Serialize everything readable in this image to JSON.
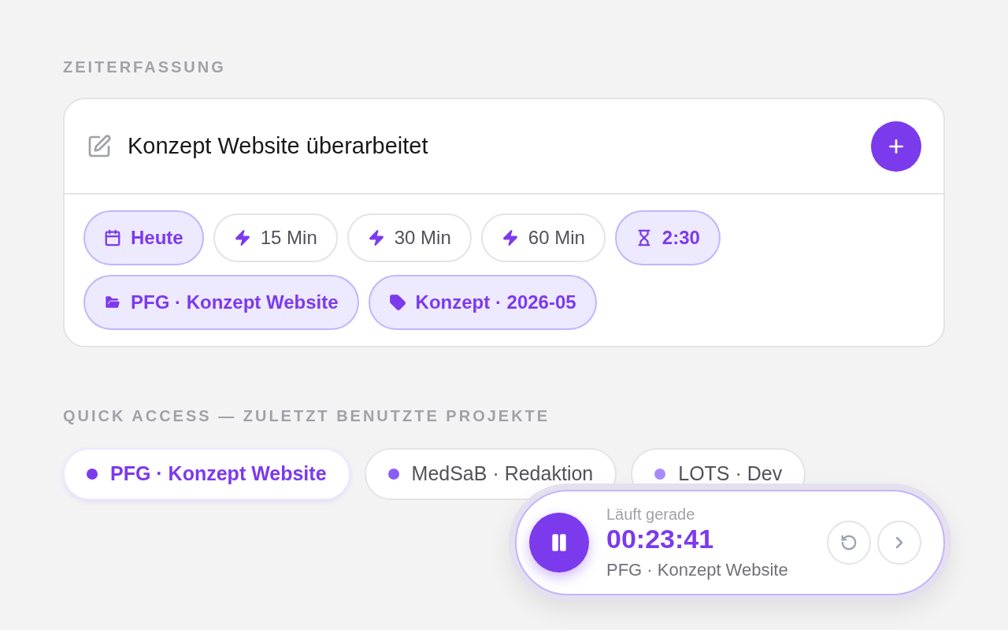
{
  "section_title": "ZEITERFASSUNG",
  "entry": {
    "description": "Konzept Website überarbeitet"
  },
  "chips": [
    {
      "kind": "date",
      "label": "Heute",
      "selected": true
    },
    {
      "kind": "quick",
      "label": "15 Min",
      "selected": false
    },
    {
      "kind": "quick",
      "label": "30 Min",
      "selected": false
    },
    {
      "kind": "quick",
      "label": "60 Min",
      "selected": false
    },
    {
      "kind": "duration",
      "label": "2:30",
      "selected": true
    },
    {
      "kind": "project",
      "label": "PFG · Konzept Website",
      "selected": true
    },
    {
      "kind": "tag",
      "label": "Konzept · 2026-05",
      "selected": true
    }
  ],
  "quick_access": {
    "title": "QUICK ACCESS — ZULETZT BENUTZTE PROJEKTE",
    "projects": [
      {
        "label": "PFG · Konzept Website",
        "color": "#7c3aed",
        "selected": true
      },
      {
        "label": "MedSaB · Redaktion",
        "color": "#8b5cf6",
        "selected": false
      },
      {
        "label": "LOTS · Dev",
        "color": "#a78bfa",
        "selected": false
      }
    ]
  },
  "timer": {
    "status": "Läuft gerade",
    "elapsed": "00:23:41",
    "project": "PFG · Konzept Website"
  }
}
